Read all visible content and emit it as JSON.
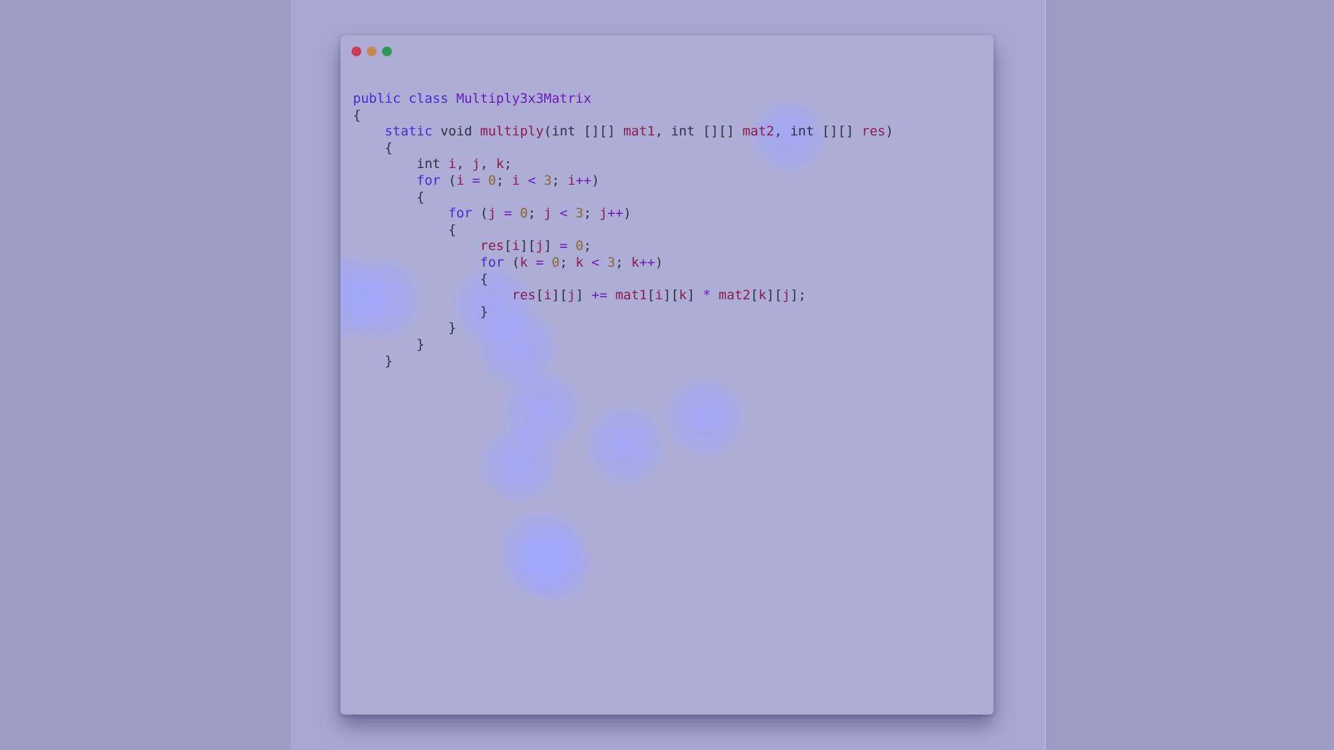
{
  "window": {
    "controls": [
      "close",
      "minimize",
      "maximize"
    ],
    "colors": {
      "close": "#c93d55",
      "minimize": "#c58a4b",
      "maximize": "#2f9a55"
    }
  },
  "code": {
    "language": "java",
    "lines": [
      [
        {
          "t": "kw",
          "v": "public class "
        },
        {
          "t": "cls",
          "v": "Multiply3x3Matrix"
        }
      ],
      [
        {
          "t": "pl",
          "v": "{"
        }
      ],
      [
        {
          "t": "pl",
          "v": "    "
        },
        {
          "t": "kw",
          "v": "static"
        },
        {
          "t": "pl",
          "v": " void "
        },
        {
          "t": "fn",
          "v": "multiply"
        },
        {
          "t": "pl",
          "v": "(int [][] "
        },
        {
          "t": "var",
          "v": "mat1"
        },
        {
          "t": "pl",
          "v": ", int [][] "
        },
        {
          "t": "var",
          "v": "mat2"
        },
        {
          "t": "pl",
          "v": ", int [][] "
        },
        {
          "t": "var",
          "v": "res"
        },
        {
          "t": "pl",
          "v": ")"
        }
      ],
      [
        {
          "t": "pl",
          "v": "    {"
        }
      ],
      [
        {
          "t": "pl",
          "v": "        int "
        },
        {
          "t": "var",
          "v": "i"
        },
        {
          "t": "pl",
          "v": ", "
        },
        {
          "t": "var",
          "v": "j"
        },
        {
          "t": "pl",
          "v": ", "
        },
        {
          "t": "var",
          "v": "k"
        },
        {
          "t": "pl",
          "v": ";"
        }
      ],
      [
        {
          "t": "pl",
          "v": "        "
        },
        {
          "t": "kw",
          "v": "for"
        },
        {
          "t": "pl",
          "v": " ("
        },
        {
          "t": "var",
          "v": "i"
        },
        {
          "t": "op",
          "v": " = "
        },
        {
          "t": "num",
          "v": "0"
        },
        {
          "t": "pl",
          "v": "; "
        },
        {
          "t": "var",
          "v": "i"
        },
        {
          "t": "op",
          "v": " < "
        },
        {
          "t": "num",
          "v": "3"
        },
        {
          "t": "pl",
          "v": "; "
        },
        {
          "t": "var",
          "v": "i"
        },
        {
          "t": "op",
          "v": "++"
        },
        {
          "t": "pl",
          "v": ")"
        }
      ],
      [
        {
          "t": "pl",
          "v": "        {"
        }
      ],
      [
        {
          "t": "pl",
          "v": "            "
        },
        {
          "t": "kw",
          "v": "for"
        },
        {
          "t": "pl",
          "v": " ("
        },
        {
          "t": "var",
          "v": "j"
        },
        {
          "t": "op",
          "v": " = "
        },
        {
          "t": "num",
          "v": "0"
        },
        {
          "t": "pl",
          "v": "; "
        },
        {
          "t": "var",
          "v": "j"
        },
        {
          "t": "op",
          "v": " < "
        },
        {
          "t": "num",
          "v": "3"
        },
        {
          "t": "pl",
          "v": "; "
        },
        {
          "t": "var",
          "v": "j"
        },
        {
          "t": "op",
          "v": "++"
        },
        {
          "t": "pl",
          "v": ")"
        }
      ],
      [
        {
          "t": "pl",
          "v": "            {"
        }
      ],
      [
        {
          "t": "pl",
          "v": "                "
        },
        {
          "t": "var",
          "v": "res"
        },
        {
          "t": "pl",
          "v": "["
        },
        {
          "t": "var",
          "v": "i"
        },
        {
          "t": "pl",
          "v": "]["
        },
        {
          "t": "var",
          "v": "j"
        },
        {
          "t": "pl",
          "v": "]"
        },
        {
          "t": "op",
          "v": " = "
        },
        {
          "t": "num",
          "v": "0"
        },
        {
          "t": "pl",
          "v": ";"
        }
      ],
      [
        {
          "t": "pl",
          "v": "                "
        },
        {
          "t": "kw",
          "v": "for"
        },
        {
          "t": "pl",
          "v": " ("
        },
        {
          "t": "var",
          "v": "k"
        },
        {
          "t": "op",
          "v": " = "
        },
        {
          "t": "num",
          "v": "0"
        },
        {
          "t": "pl",
          "v": "; "
        },
        {
          "t": "var",
          "v": "k"
        },
        {
          "t": "op",
          "v": " < "
        },
        {
          "t": "num",
          "v": "3"
        },
        {
          "t": "pl",
          "v": "; "
        },
        {
          "t": "var",
          "v": "k"
        },
        {
          "t": "op",
          "v": "++"
        },
        {
          "t": "pl",
          "v": ")"
        }
      ],
      [
        {
          "t": "pl",
          "v": "                {"
        }
      ],
      [
        {
          "t": "pl",
          "v": "                    "
        },
        {
          "t": "var",
          "v": "res"
        },
        {
          "t": "pl",
          "v": "["
        },
        {
          "t": "var",
          "v": "i"
        },
        {
          "t": "pl",
          "v": "]["
        },
        {
          "t": "var",
          "v": "j"
        },
        {
          "t": "pl",
          "v": "]"
        },
        {
          "t": "op",
          "v": " += "
        },
        {
          "t": "var",
          "v": "mat1"
        },
        {
          "t": "pl",
          "v": "["
        },
        {
          "t": "var",
          "v": "i"
        },
        {
          "t": "pl",
          "v": "]["
        },
        {
          "t": "var",
          "v": "k"
        },
        {
          "t": "pl",
          "v": "]"
        },
        {
          "t": "op",
          "v": " * "
        },
        {
          "t": "var",
          "v": "mat2"
        },
        {
          "t": "pl",
          "v": "["
        },
        {
          "t": "var",
          "v": "k"
        },
        {
          "t": "pl",
          "v": "]["
        },
        {
          "t": "var",
          "v": "j"
        },
        {
          "t": "pl",
          "v": "];"
        }
      ],
      [
        {
          "t": "pl",
          "v": "                }"
        }
      ],
      [
        {
          "t": "pl",
          "v": "            }"
        }
      ],
      [
        {
          "t": "pl",
          "v": "        }"
        }
      ],
      [
        {
          "t": "pl",
          "v": "    }"
        }
      ]
    ]
  },
  "theme": {
    "page_background": "#9c9cc4",
    "stage_background": "#a8a8d2",
    "window_background": "#adadd5",
    "keyword": "#3f2ed2",
    "class_name": "#6a1ab8",
    "identifier": "#8a1c4e",
    "number": "#8a6a30",
    "plain": "#2f2f46"
  }
}
